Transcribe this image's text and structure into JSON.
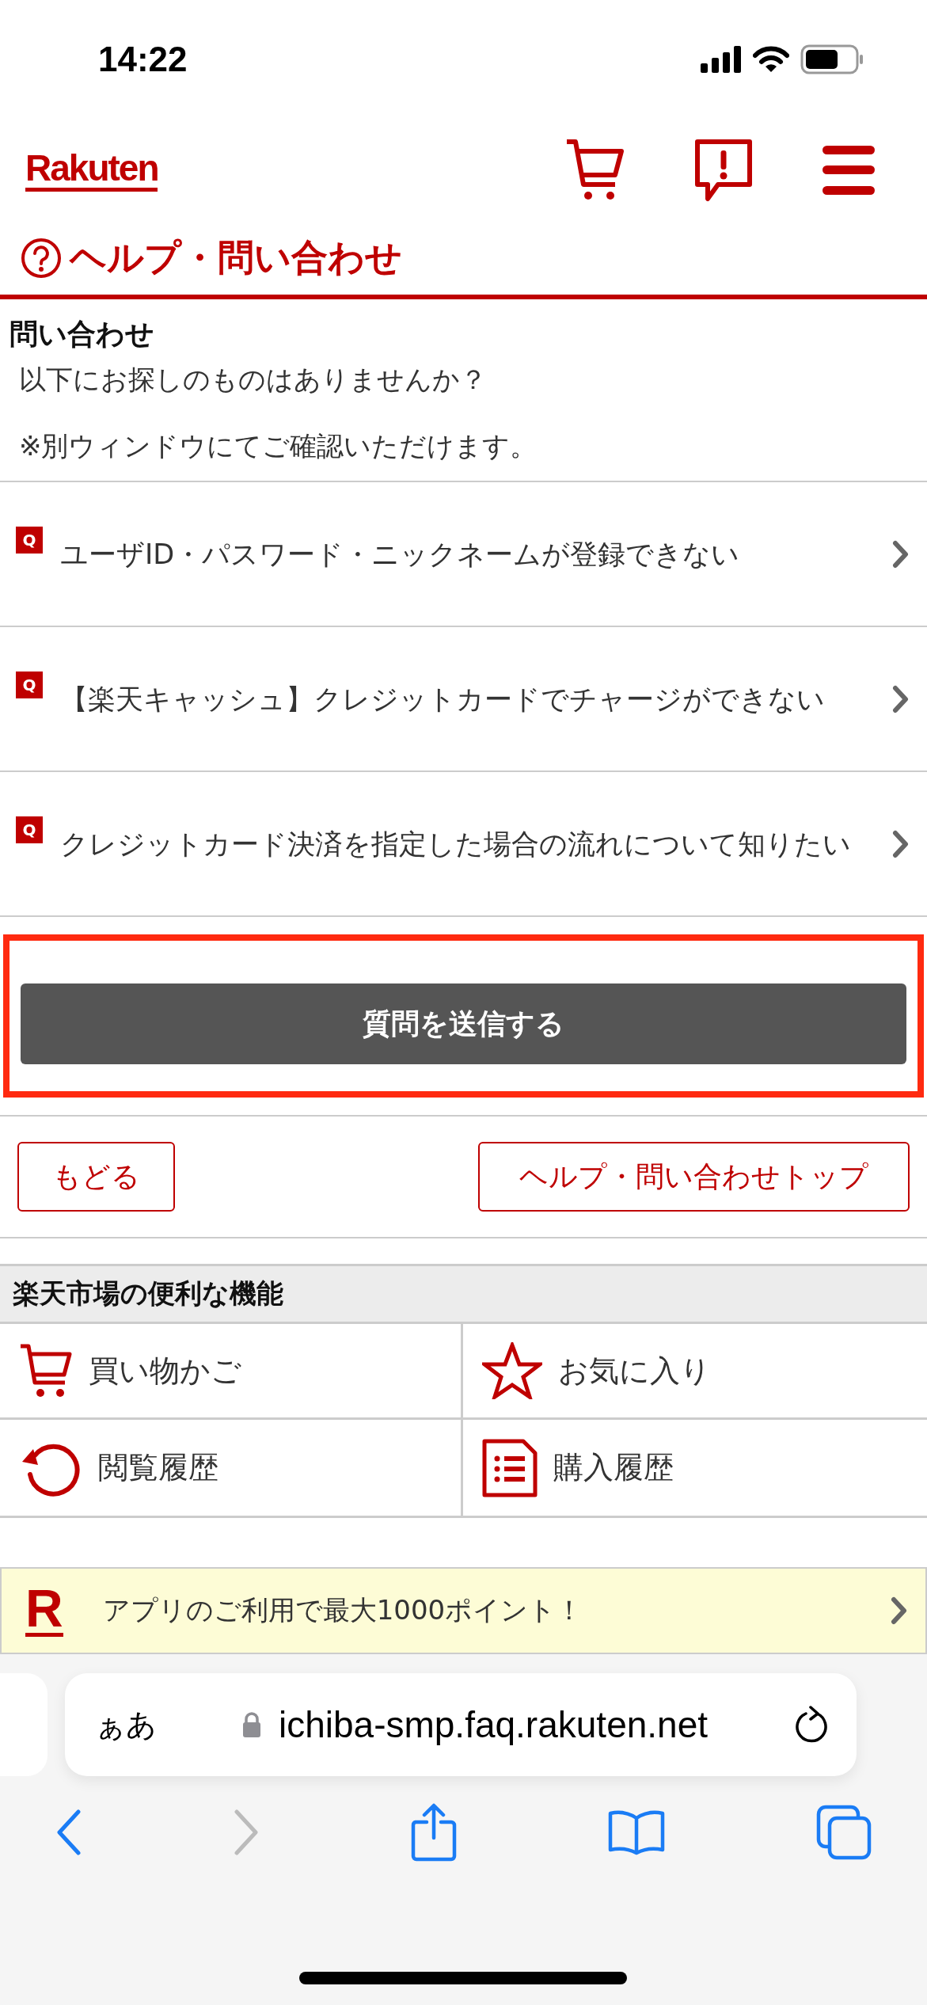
{
  "status_bar": {
    "time": "14:22"
  },
  "header": {
    "logo": "Rakuten"
  },
  "page_title": "ヘルプ・問い合わせ",
  "section_title": "問い合わせ",
  "intro": [
    "以下にお探しのものはありませんか？",
    "※別ウィンドウにてご確認いただけます。"
  ],
  "faq": [
    {
      "badge": "Q",
      "text": "ユーザID・パスワード・ニックネームが登録できない"
    },
    {
      "badge": "Q",
      "text": "【楽天キャッシュ】クレジットカードでチャージができない"
    },
    {
      "badge": "Q",
      "text": "クレジットカード決済を指定した場合の流れについて知りたい"
    }
  ],
  "submit_button": {
    "label": "質問を送信する",
    "highlighted": true
  },
  "nav_buttons": [
    "もどる",
    "ヘルプ・問い合わせトップ"
  ],
  "features": {
    "title": "楽天市場の便利な機能",
    "items": [
      {
        "kind": "cart",
        "label": "買い物かご"
      },
      {
        "kind": "star",
        "label": "お気に入り"
      },
      {
        "kind": "history",
        "label": "閲覧履歴"
      },
      {
        "kind": "list",
        "label": "購入履歴"
      }
    ]
  },
  "banner": {
    "logo": "R",
    "text": "アプリのご利用で最大1000ポイント！"
  },
  "browser": {
    "text_size": "ぁあ",
    "url": "ichiba-smp.faq.rakuten.net"
  }
}
